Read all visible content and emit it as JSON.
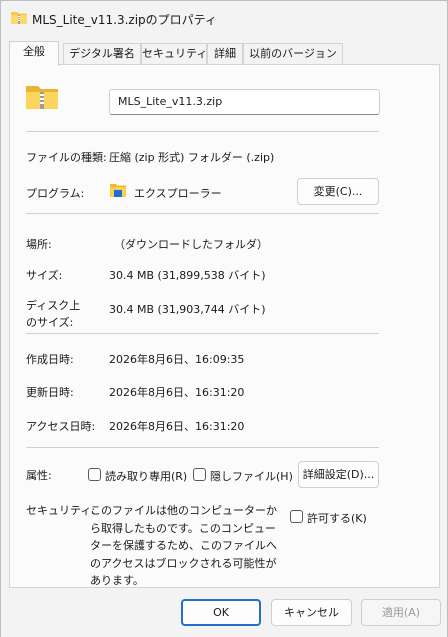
{
  "window": {
    "title": "MLS_Lite_v11.3.zipのプロパティ",
    "icon": "zip-folder-icon"
  },
  "tabs": [
    {
      "label": "全般",
      "active": true
    },
    {
      "label": "デジタル署名",
      "active": false
    },
    {
      "label": "セキュリティ",
      "active": false
    },
    {
      "label": "詳細",
      "active": false
    },
    {
      "label": "以前のバージョン",
      "active": false
    }
  ],
  "general": {
    "filename": "MLS_Lite_v11.3.zip",
    "file_type_label": "ファイルの種類:",
    "file_type_value": "圧縮 (zip 形式) フォルダー (.zip)",
    "program_label": "プログラム:",
    "program_value": "エクスプローラー",
    "change_button": "変更(C)...",
    "location_label": "場所:",
    "location_value": "（ダウンロードしたフォルダ）",
    "size_label": "サイズ:",
    "size_value": "30.4 MB (31,899,538 バイト)",
    "disk_size_label_line1": "ディスク上",
    "disk_size_label_line2": "のサイズ:",
    "disk_size_value": "30.4 MB (31,903,744 バイト)",
    "created_label": "作成日時:",
    "created_value": "2026年8月6日、16:09:35",
    "modified_label": "更新日時:",
    "modified_value": "2026年8月6日、16:31:20",
    "accessed_label": "アクセス日時:",
    "accessed_value": "2026年8月6日、16:31:20",
    "attributes_label": "属性:",
    "readonly_label": "読み取り専用(R)",
    "readonly_checked": false,
    "hidden_label": "隠しファイル(H)",
    "hidden_checked": false,
    "advanced_button": "詳細設定(D)...",
    "security_label": "セキュリティ:",
    "security_text": "このファイルは他のコンピューターから取得したものです。このコンピューターを保護するため、このファイルへのアクセスはブロックされる可能性があります。",
    "unblock_label": "許可する(K)",
    "unblock_checked": false
  },
  "footer": {
    "ok": "OK",
    "cancel": "キャンセル",
    "apply": "適用(A)"
  },
  "colors": {
    "accent": "#1f6fd1",
    "folder_yellow": "#f6c94a"
  }
}
